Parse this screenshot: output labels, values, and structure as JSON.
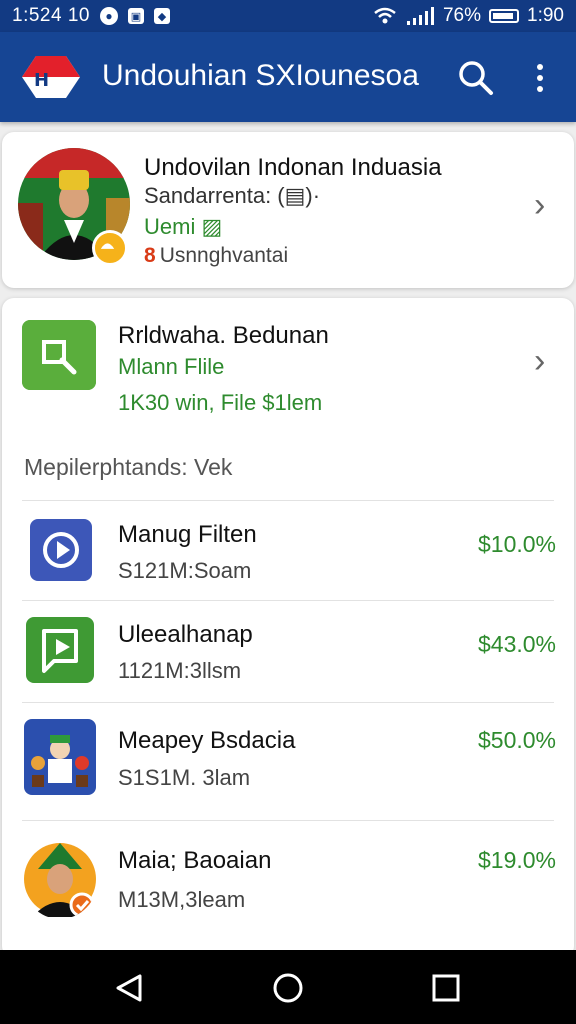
{
  "status": {
    "time": "1:524 10",
    "battery_text": "76%",
    "clock": "1:90"
  },
  "appbar": {
    "logo_text": "H",
    "title": "Undouhian SXIounesoa"
  },
  "profile": {
    "name": "Undovilan Indonan Induasia",
    "subtitle": "Sandarrenta: (▤)·",
    "tag": "Uemi ▨",
    "location_prefix": "8",
    "location": "Usnnghvantai"
  },
  "featured": {
    "title": "Rrldwaha. Bedunan",
    "subtitle": "Mlann Flile",
    "meta": "1K30 win, File  $1lem"
  },
  "section_label": "Mepilerphtands: Vek",
  "rows": [
    {
      "title": "Manug Filten",
      "meta": "S121M:Soam",
      "value": "$10.0%"
    },
    {
      "title": "Uleealhanap",
      "meta": "1121M:3llsm",
      "value": "$43.0%"
    },
    {
      "title": "Meapey Bsdacia",
      "meta": "S1S1M. 3lam",
      "value": "$50.0%"
    },
    {
      "title": "Maia; Baoaian",
      "meta": "M13M,3leam",
      "value": "$19.0%"
    }
  ],
  "colors": {
    "appbar": "#164594",
    "statusbar": "#123a83",
    "accent_green": "#2e8b2e"
  }
}
